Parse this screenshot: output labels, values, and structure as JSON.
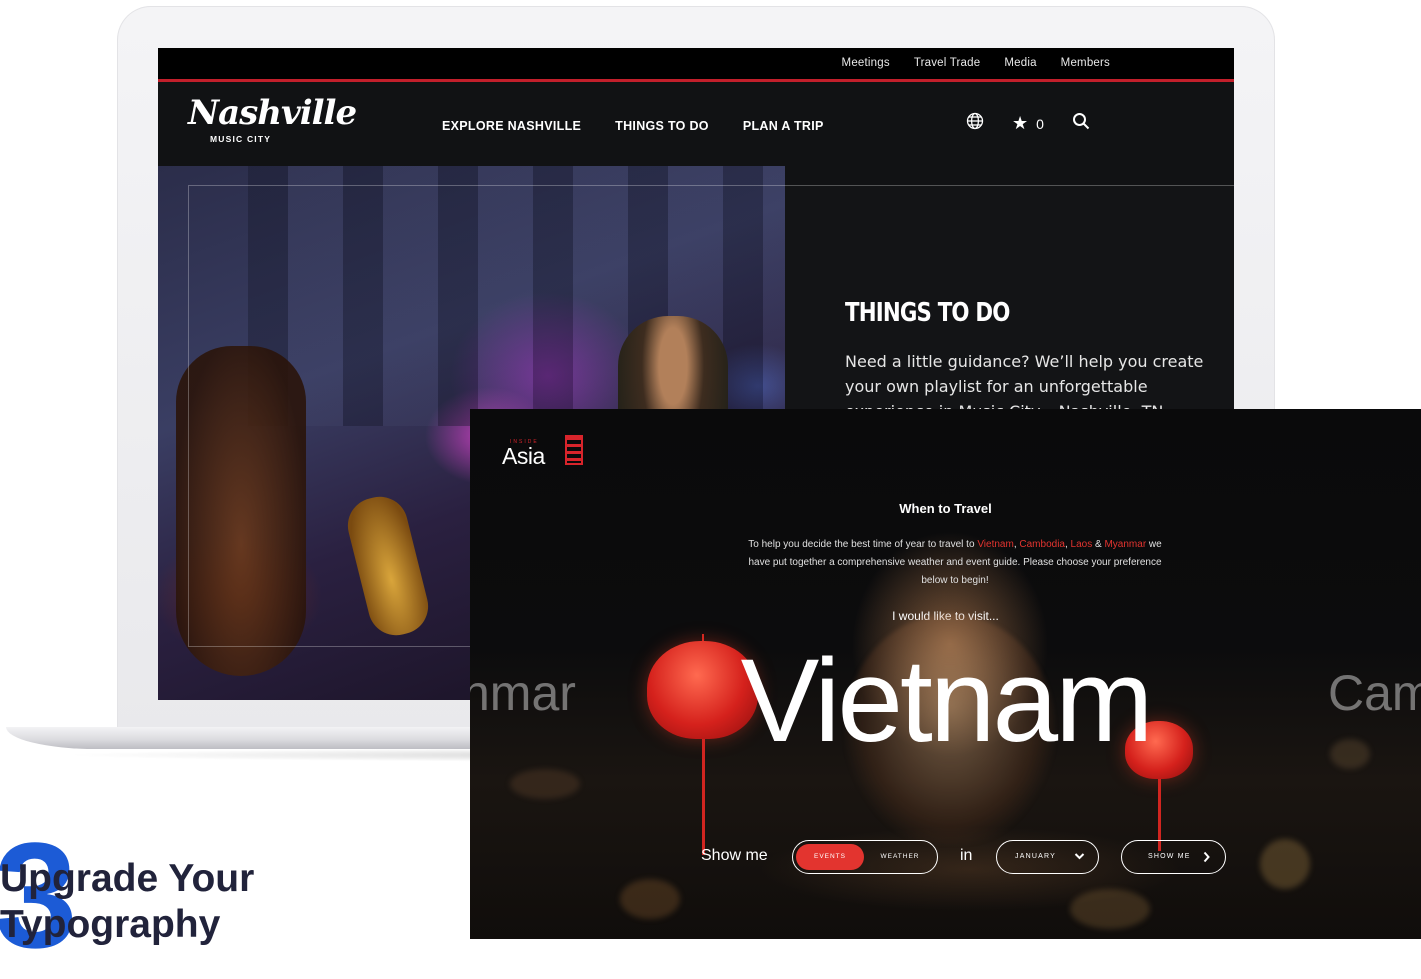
{
  "nashville": {
    "utility_links": [
      "Meetings",
      "Travel Trade",
      "Media",
      "Members"
    ],
    "logo": {
      "main": "Nashville",
      "sub": "MUSIC CITY"
    },
    "nav_items": [
      "EXPLORE NASHVILLE",
      "THINGS TO DO",
      "PLAN A TRIP"
    ],
    "icons": {
      "language": "globe-icon",
      "favorites": "star-icon",
      "search": "search-icon"
    },
    "favorites_count": "0",
    "hero": {
      "title": "THINGS TO DO",
      "description": "Need a little guidance? We’ll help you create your own playlist for an unforgettable experience in Music City – Nashville, TN."
    },
    "colors": {
      "accent": "#c21f2b",
      "background": "#111214"
    }
  },
  "inside_asia": {
    "logo_small": "INSIDE",
    "logo": "Asia",
    "title": "When to Travel",
    "intro": {
      "part1": "To help you decide the best time of year to travel to ",
      "vietnam": "Vietnam",
      "sep1": ", ",
      "cambodia": "Cambodia",
      "sep2": ", ",
      "laos": "Laos",
      "sep3": " & ",
      "myanmar": "Myanmar",
      "part2": " we have put together a comprehensive weather and event guide. Please choose your preference below to begin!"
    },
    "prompt": "I would like to visit...",
    "carousel": {
      "current": "Vietnam",
      "prev": "nmar",
      "next": "Cam"
    },
    "form": {
      "show_me_label": "Show me",
      "toggle_events": "EVENTS",
      "toggle_weather": "WEATHER",
      "selected_toggle": "EVENTS",
      "in_label": "in",
      "month_value": "JANUARY",
      "submit_label": "SHOW ME"
    },
    "colors": {
      "accent": "#e3342f"
    }
  },
  "section": {
    "number": "3",
    "title": "Upgrade Your Typography"
  }
}
